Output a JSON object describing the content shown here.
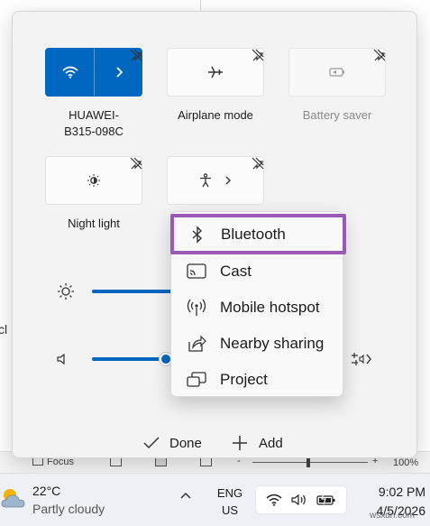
{
  "background_app": {
    "cut_text": "cl",
    "status_bar": {
      "focus_label": "Focus",
      "zoom_minus": "-",
      "zoom_plus": "+",
      "zoom_percent": "100%"
    }
  },
  "quick_settings": {
    "tiles": [
      {
        "id": "wifi",
        "label": "HUAWEI-B315-098C",
        "label_line1": "HUAWEI-",
        "label_line2": "B315-098C",
        "active": true,
        "icon": "wifi-icon",
        "has_chevron": true
      },
      {
        "id": "airplane",
        "label": "Airplane mode",
        "active": false,
        "icon": "airplane-icon"
      },
      {
        "id": "battery_saver",
        "label": "Battery saver",
        "active": false,
        "disabled": true,
        "icon": "battery-saver-icon"
      },
      {
        "id": "night_light",
        "label": "Night light",
        "active": false,
        "icon": "night-light-icon"
      },
      {
        "id": "accessibility",
        "label": "",
        "active": false,
        "icon": "accessibility-icon",
        "has_chevron": true
      }
    ],
    "brightness_level": 0.75,
    "volume_level": 0.72,
    "footer": {
      "done_label": "Done",
      "add_label": "Add"
    },
    "colors": {
      "accent": "#0067c0",
      "highlight_border": "#9b59b6"
    }
  },
  "add_menu": {
    "items": [
      {
        "label": "Bluetooth",
        "icon": "bluetooth-icon",
        "highlighted": true
      },
      {
        "label": "Cast",
        "icon": "cast-icon"
      },
      {
        "label": "Mobile hotspot",
        "icon": "mobile-hotspot-icon"
      },
      {
        "label": "Nearby sharing",
        "icon": "nearby-sharing-icon"
      },
      {
        "label": "Project",
        "icon": "project-icon"
      }
    ]
  },
  "taskbar": {
    "weather": {
      "temp": "22°C",
      "condition": "Partly cloudy",
      "icon": "partly-cloudy-icon"
    },
    "language": {
      "line1": "ENG",
      "line2": "US"
    },
    "clock": {
      "time": "9:02 PM",
      "date": "4/5/2026"
    }
  },
  "watermark": "wsxdn.com"
}
